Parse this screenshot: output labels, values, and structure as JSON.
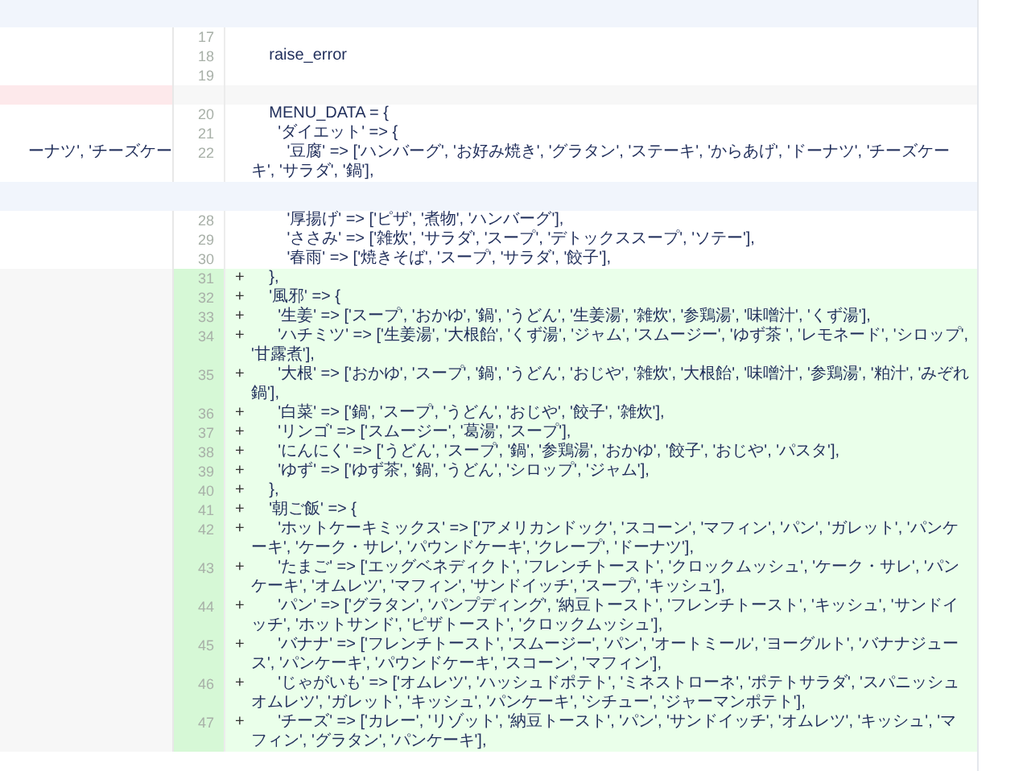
{
  "hunks": [
    {
      "rows": [
        {
          "kind": "context",
          "number": "17",
          "text": ""
        },
        {
          "kind": "context",
          "number": "18",
          "text": "    raise_error"
        },
        {
          "kind": "context",
          "number": "19",
          "text": ""
        },
        {
          "kind": "removed",
          "number": "",
          "text": ""
        },
        {
          "kind": "context",
          "number": "20",
          "text": "    MENU_DATA = {"
        },
        {
          "kind": "context",
          "number": "21",
          "text": "      'ダイエット' => {"
        },
        {
          "kind": "context",
          "number": "22",
          "left_text": "ーナツ', 'チーズケー",
          "text": "        '豆腐' => ['ハンバーグ', 'お好み焼き', 'グラタン', 'ステーキ', 'からあげ', 'ドーナツ', 'チーズケーキ', 'サラダ', '鍋'],"
        }
      ]
    },
    {
      "rows": [
        {
          "kind": "context",
          "number": "28",
          "text": "        '厚揚げ' => ['ピザ', '煮物', 'ハンバーグ'],"
        },
        {
          "kind": "context",
          "number": "29",
          "text": "        'ささみ' => ['雑炊', 'サラダ', 'スープ', 'デトックススープ', 'ソテー'],"
        },
        {
          "kind": "context",
          "number": "30",
          "text": "        '春雨' => ['焼きそば', 'スープ', 'サラダ', '餃子'],"
        },
        {
          "kind": "added",
          "number": "31",
          "marker": "+",
          "text": "    },"
        },
        {
          "kind": "added",
          "number": "32",
          "marker": "+",
          "text": "    '風邪' => {"
        },
        {
          "kind": "added",
          "number": "33",
          "marker": "+",
          "text": "      '生姜' => ['スープ', 'おかゆ', '鍋', 'うどん', '生姜湯', '雑炊', '参鶏湯', '味噌汁', 'くず湯'],"
        },
        {
          "kind": "added",
          "number": "34",
          "marker": "+",
          "text": "      'ハチミツ' => ['生姜湯', '大根飴', 'くず湯', 'ジャム', 'スムージー', 'ゆず茶 ', 'レモネード', 'シロップ', '甘露煮'],"
        },
        {
          "kind": "added",
          "number": "35",
          "marker": "+",
          "text": "      '大根' => ['おかゆ', 'スープ', '鍋', 'うどん', 'おじや', '雑炊', '大根飴', '味噌汁', '参鶏湯', '粕汁', 'みぞれ鍋'],"
        },
        {
          "kind": "added",
          "number": "36",
          "marker": "+",
          "text": "      '白菜' => ['鍋', 'スープ', 'うどん', 'おじや', '餃子', '雑炊'],"
        },
        {
          "kind": "added",
          "number": "37",
          "marker": "+",
          "text": "      'リンゴ' => ['スムージー', '葛湯', 'スープ'],"
        },
        {
          "kind": "added",
          "number": "38",
          "marker": "+",
          "text": "      'にんにく' => ['うどん', 'スープ', '鍋', '参鶏湯', 'おかゆ', '餃子', 'おじや', 'パスタ'],"
        },
        {
          "kind": "added",
          "number": "39",
          "marker": "+",
          "text": "      'ゆず' => ['ゆず茶', '鍋', 'うどん', 'シロップ', 'ジャム'],"
        },
        {
          "kind": "added",
          "number": "40",
          "marker": "+",
          "text": "    },"
        },
        {
          "kind": "added",
          "number": "41",
          "marker": "+",
          "text": "    '朝ご飯' => {"
        },
        {
          "kind": "added",
          "number": "42",
          "marker": "+",
          "text": "      'ホットケーキミックス' => ['アメリカンドック', 'スコーン', 'マフィン', 'パン', 'ガレット', 'パンケーキ', 'ケーク・サレ', 'パウンドケーキ', 'クレープ', 'ドーナツ'],"
        },
        {
          "kind": "added",
          "number": "43",
          "marker": "+",
          "text": "      'たまご' => ['エッグベネディクト', 'フレンチトースト', 'クロックムッシュ', 'ケーク・サレ', 'パンケーキ', 'オムレツ', 'マフィン', 'サンドイッチ', 'スープ', 'キッシュ'],"
        },
        {
          "kind": "added",
          "number": "44",
          "marker": "+",
          "text": "      'パン' => ['グラタン', 'パンプディング', '納豆トースト', 'フレンチトースト', 'キッシュ', 'サンドイッチ', 'ホットサンド', 'ピザトースト', 'クロックムッシュ'],"
        },
        {
          "kind": "added",
          "number": "45",
          "marker": "+",
          "text": "      'バナナ' => ['フレンチトースト', 'スムージー', 'パン', 'オートミール', 'ヨーグルト', 'バナナジュース', 'パンケーキ', 'パウンドケーキ', 'スコーン', 'マフィン'],"
        },
        {
          "kind": "added",
          "number": "46",
          "marker": "+",
          "text": "      'じゃがいも' => ['オムレツ', 'ハッシュドポテト', 'ミネストローネ', 'ポテトサラダ', 'スパニッシュオムレツ', 'ガレット', 'キッシュ', 'パンケーキ', 'シチュー', 'ジャーマンポテト'],"
        },
        {
          "kind": "added",
          "number": "47",
          "marker": "+",
          "text": "      'チーズ' => ['カレー', 'リゾット', '納豆トースト', 'パン', 'サンドイッチ', 'オムレツ', 'キッシュ', 'マフィン', 'グラタン', 'パンケーキ'],"
        }
      ]
    }
  ]
}
